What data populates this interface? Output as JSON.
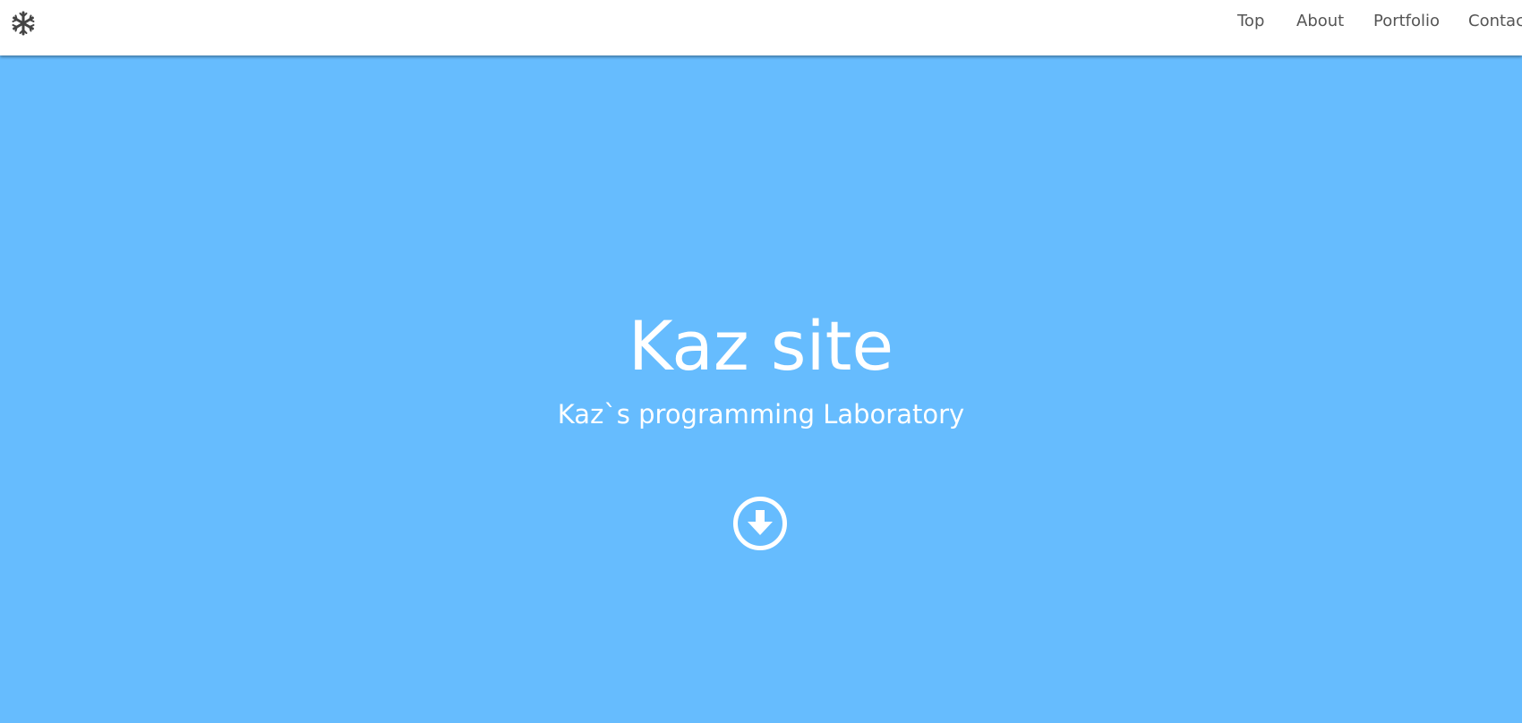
{
  "navbar": {
    "brand_icon": "snowflake-icon",
    "links": [
      {
        "label": "Top"
      },
      {
        "label": "About"
      },
      {
        "label": "Portfolio"
      },
      {
        "label": "Contac"
      }
    ]
  },
  "hero": {
    "title": "Kaz site",
    "subtitle": "Kaz`s programming Laboratory",
    "scroll_icon": "arrow-circle-down-icon",
    "background_color": "#66bcfe",
    "text_color": "#ffffff"
  },
  "colors": {
    "nav_text": "#555555",
    "nav_background": "#ffffff",
    "icon": "#444444"
  }
}
